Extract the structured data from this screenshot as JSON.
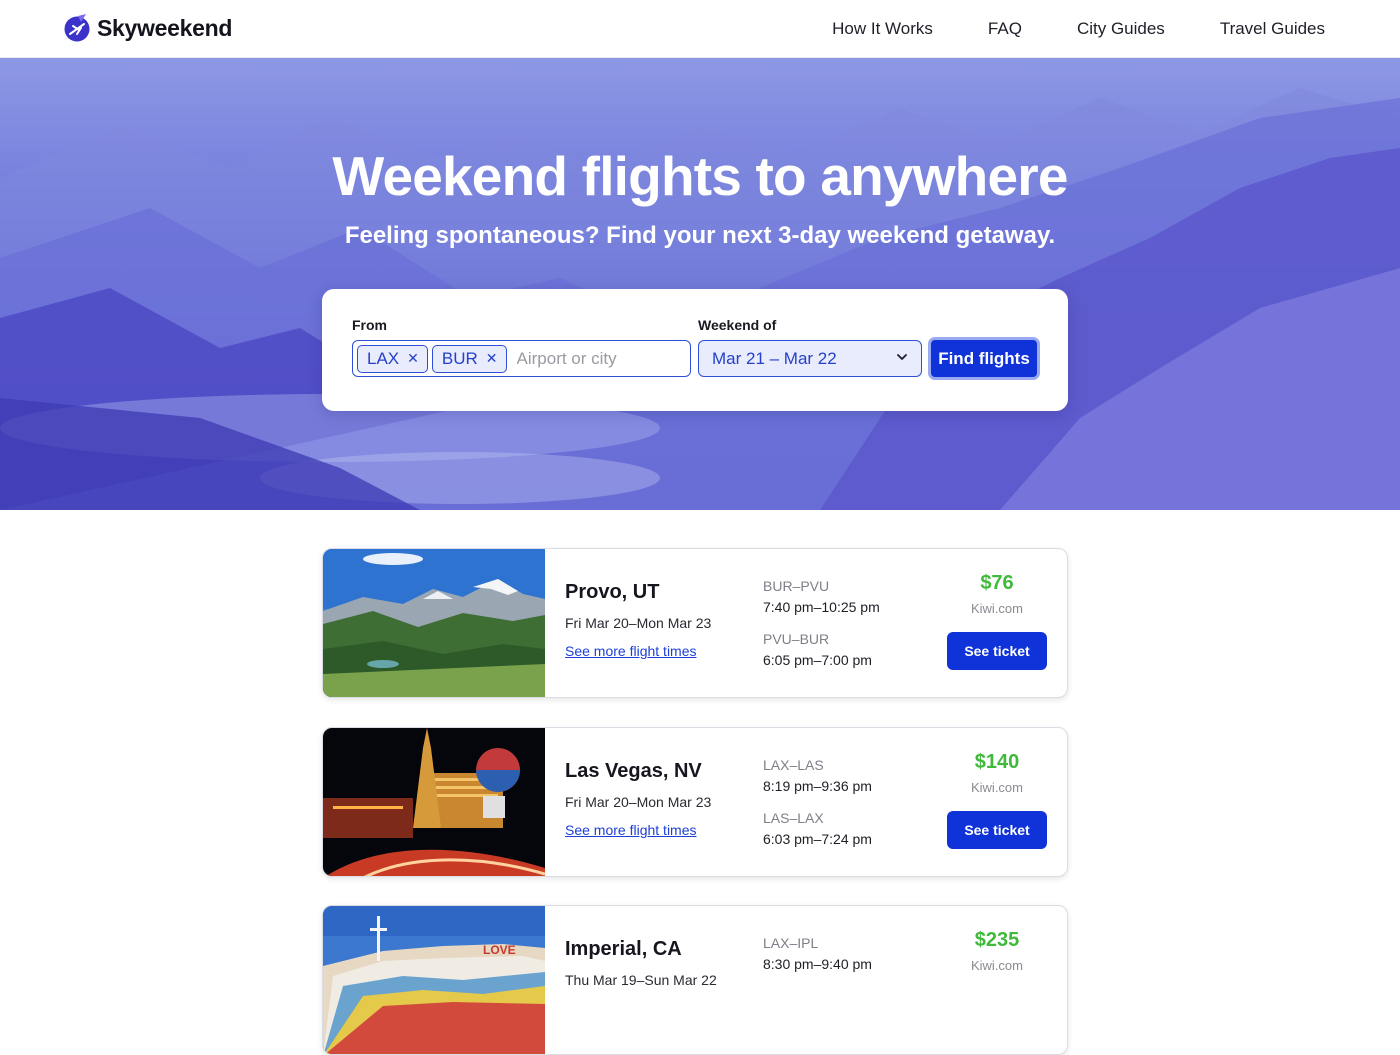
{
  "brand": {
    "name": "Skyweekend"
  },
  "nav": [
    {
      "label": "How It Works"
    },
    {
      "label": "FAQ"
    },
    {
      "label": "City Guides"
    },
    {
      "label": "Travel Guides"
    }
  ],
  "hero": {
    "title": "Weekend flights to anywhere",
    "subtitle": "Feeling spontaneous? Find your next 3-day weekend getaway."
  },
  "search": {
    "from_label": "From",
    "from_chips": [
      "LAX",
      "BUR"
    ],
    "from_placeholder": "Airport or city",
    "weekend_label": "Weekend of",
    "weekend_value": "Mar 21 – Mar 22",
    "submit_label": "Find flights"
  },
  "results": [
    {
      "city": "Provo, UT",
      "dates": "Fri Mar 20–Mon Mar 23",
      "more_link": "See more flight times",
      "outbound_route": "BUR–PVU",
      "outbound_time": "7:40 pm–10:25 pm",
      "return_route": "PVU–BUR",
      "return_time": "6:05 pm–7:00 pm",
      "price": "$76",
      "vendor": "Kiwi.com",
      "cta": "See ticket",
      "image": "mountain-valley-photo"
    },
    {
      "city": "Las Vegas, NV",
      "dates": "Fri Mar 20–Mon Mar 23",
      "more_link": "See more flight times",
      "outbound_route": "LAX–LAS",
      "outbound_time": "8:19 pm–9:36 pm",
      "return_route": "LAS–LAX",
      "return_time": "6:03 pm–7:24 pm",
      "price": "$140",
      "vendor": "Kiwi.com",
      "cta": "See ticket",
      "image": "las-vegas-night-photo"
    },
    {
      "city": "Imperial, CA",
      "dates": "Thu Mar 19–Sun Mar 22",
      "outbound_route": "LAX–IPL",
      "outbound_time": "8:30 pm–9:40 pm",
      "price": "$235",
      "vendor": "Kiwi.com",
      "image": "salvation-mountain-photo"
    }
  ],
  "colors": {
    "accent": "#0f33d8",
    "price": "#3fba3b",
    "hero": "#5a5dd2"
  }
}
